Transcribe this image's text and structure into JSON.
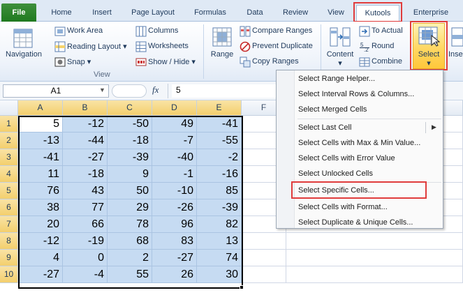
{
  "tabs": [
    {
      "id": "file",
      "label": "File"
    },
    {
      "id": "home",
      "label": "Home"
    },
    {
      "id": "insert",
      "label": "Insert"
    },
    {
      "id": "page_layout",
      "label": "Page Layout"
    },
    {
      "id": "formulas",
      "label": "Formulas"
    },
    {
      "id": "data",
      "label": "Data"
    },
    {
      "id": "review",
      "label": "Review"
    },
    {
      "id": "view",
      "label": "View"
    },
    {
      "id": "kutools",
      "label": "Kutools"
    },
    {
      "id": "enterprise",
      "label": "Enterprise"
    }
  ],
  "ribbon": {
    "navigation": "Navigation",
    "work_area": "Work Area",
    "reading_layout": "Reading Layout",
    "snap": "Snap",
    "columns": "Columns",
    "worksheets": "Worksheets",
    "show_hide": "Show / Hide",
    "view_group": "View",
    "range": "Range",
    "compare_ranges": "Compare Ranges",
    "prevent_duplicate": "Prevent Duplicate",
    "copy_ranges": "Copy Ranges",
    "content": "Content",
    "to_actual": "To Actual",
    "round": "Round",
    "combine": "Combine",
    "select": "Select",
    "insert_partial": "Inse"
  },
  "formula_bar": {
    "name_box": "A1",
    "fx": "fx",
    "value": "5"
  },
  "columns": [
    "A",
    "B",
    "C",
    "D",
    "E",
    "F"
  ],
  "rows": [
    {
      "num": "1",
      "cells": [
        "5",
        "-12",
        "-50",
        "49",
        "-41"
      ]
    },
    {
      "num": "2",
      "cells": [
        "-13",
        "-44",
        "-18",
        "-7",
        "-55"
      ]
    },
    {
      "num": "3",
      "cells": [
        "-41",
        "-27",
        "-39",
        "-40",
        "-2"
      ]
    },
    {
      "num": "4",
      "cells": [
        "11",
        "-18",
        "9",
        "-1",
        "-16"
      ]
    },
    {
      "num": "5",
      "cells": [
        "76",
        "43",
        "50",
        "-10",
        "85"
      ]
    },
    {
      "num": "6",
      "cells": [
        "38",
        "77",
        "29",
        "-26",
        "-39"
      ]
    },
    {
      "num": "7",
      "cells": [
        "20",
        "66",
        "78",
        "96",
        "82"
      ]
    },
    {
      "num": "8",
      "cells": [
        "-12",
        "-19",
        "68",
        "83",
        "13"
      ]
    },
    {
      "num": "9",
      "cells": [
        "4",
        "0",
        "2",
        "-27",
        "74"
      ]
    },
    {
      "num": "10",
      "cells": [
        "-27",
        "-4",
        "55",
        "26",
        "30"
      ]
    }
  ],
  "select_menu": [
    "Select Range Helper...",
    "Select Interval Rows & Columns...",
    "Select Merged Cells",
    "Select Last Cell",
    "Select Cells with Max & Min Value...",
    "Select Cells with Error Value",
    "Select Unlocked Cells",
    "Select Specific Cells...",
    "Select Cells with Format...",
    "Select Duplicate & Unique Cells..."
  ],
  "colors": {
    "highlight": "#e03c3c",
    "selection_fill": "#c6dbf2",
    "header_selected": "#f3cf6d"
  }
}
